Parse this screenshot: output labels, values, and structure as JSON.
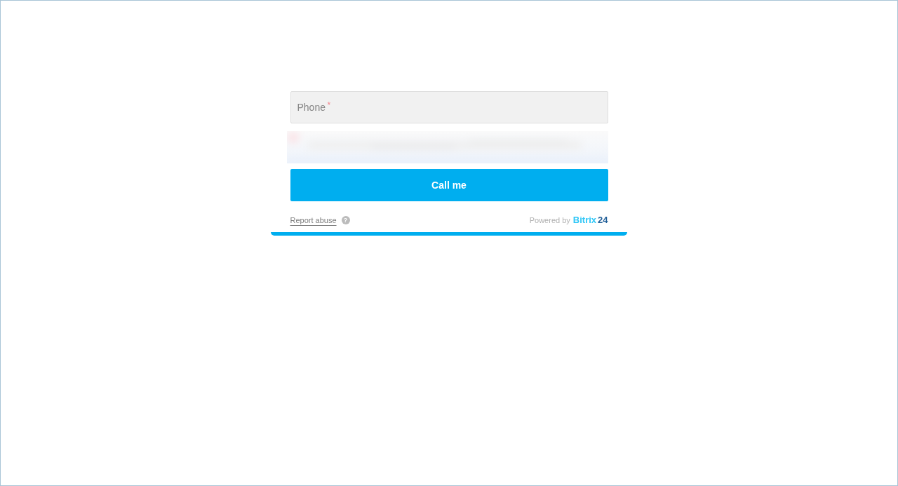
{
  "form": {
    "phone_field": {
      "placeholder": "Phone",
      "required_mark": "*"
    },
    "submit_button": "Call me",
    "footer": {
      "report_link": "Report abuse",
      "help_icon": "?",
      "powered_by": "Powered by",
      "logo_name": "Bitrix",
      "logo_number": "24"
    }
  }
}
